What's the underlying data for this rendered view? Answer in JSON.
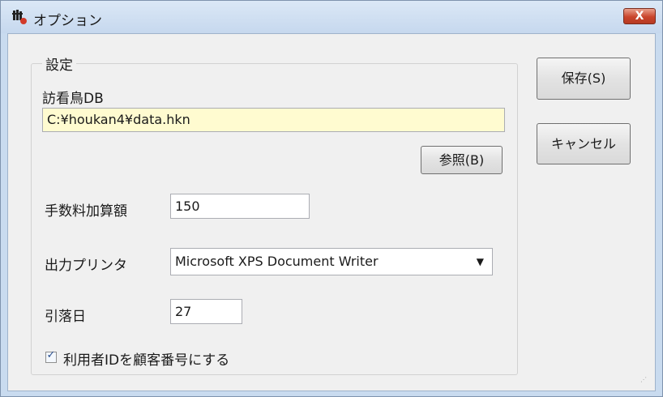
{
  "window": {
    "title": "オプション",
    "close_label": "X"
  },
  "settings": {
    "group_label": "設定",
    "db_label": "訪看鳥DB",
    "db_path": "C:¥houkan4¥data.hkn",
    "browse_label": "参照(B)",
    "fee_label": "手数料加算額",
    "fee_value": "150",
    "printer_label": "出力プリンタ",
    "printer_value": "Microsoft XPS Document Writer",
    "debit_day_label": "引落日",
    "debit_day_value": "27",
    "customer_id_checkbox_label": "利用者IDを顧客番号にする",
    "customer_id_checked": true
  },
  "actions": {
    "save_label": "保存(S)",
    "cancel_label": "キャンセル"
  },
  "icons": {
    "app": "app-icon",
    "close": "close-icon",
    "dropdown": "chevron-down-icon",
    "check": "checkmark-icon"
  }
}
